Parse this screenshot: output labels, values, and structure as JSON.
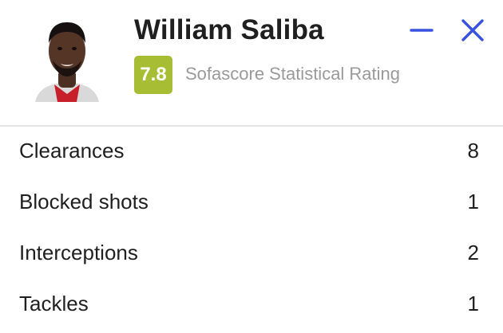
{
  "player": {
    "name": "William Saliba",
    "rating": "7.8",
    "rating_label": "Sofascore Statistical Rating",
    "rating_color": "#a6bd34",
    "avatar_icon": "player-photo"
  },
  "controls": {
    "minimize_icon": "minus-icon",
    "close_icon": "close-icon",
    "accent_color": "#3851e0"
  },
  "stats": [
    {
      "label": "Clearances",
      "value": "8"
    },
    {
      "label": "Blocked shots",
      "value": "1"
    },
    {
      "label": "Interceptions",
      "value": "2"
    },
    {
      "label": "Tackles",
      "value": "1"
    }
  ]
}
